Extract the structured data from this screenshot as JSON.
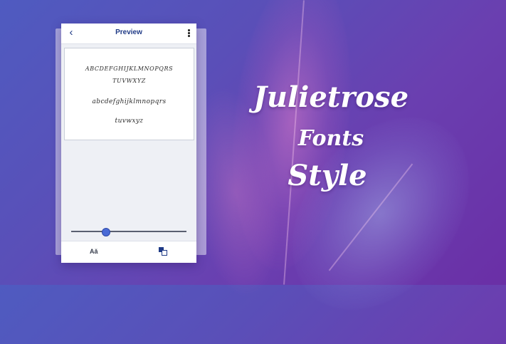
{
  "app": {
    "title": "Preview"
  },
  "preview": {
    "uppercase_line1": "ABCDEFGHIJKLMNOPQRS",
    "uppercase_line2": "TUVWXYZ",
    "lowercase_line1": "abcdefghijklmnopqrs",
    "lowercase_line2": "tuvwxyz"
  },
  "slider": {
    "level_fraction": 0.3
  },
  "bottom_bar": {
    "font_icon_glyph": "Aǎ",
    "icons": [
      "font-size-icon",
      "copy-icon"
    ]
  },
  "headline": {
    "line1": "Julietrose",
    "line2": "Fonts",
    "line3": "Style"
  },
  "colors": {
    "accent": "#1f3a86",
    "slider_thumb": "#4a6bd6"
  }
}
